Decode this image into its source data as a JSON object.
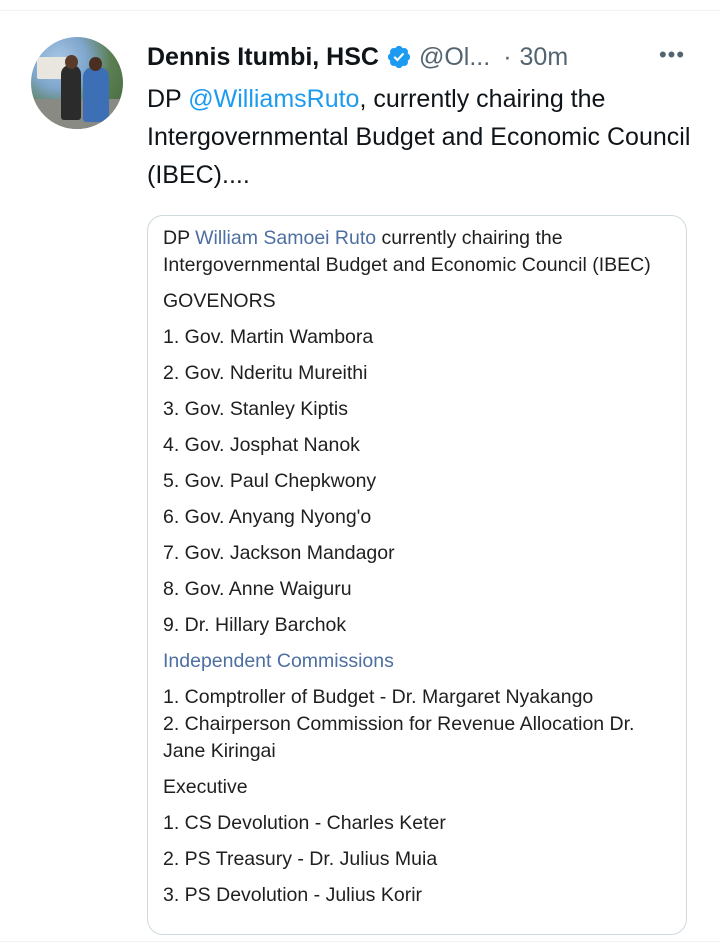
{
  "tweet": {
    "author_name": "Dennis Itumbi, HSC",
    "handle": "@Ol...",
    "separator": "·",
    "time": "30m",
    "more_label": "•••",
    "text_prefix": "DP ",
    "text_mention": "@WilliamsRuto",
    "text_suffix": ", currently chairing the Intergovernmental Budget and Economic Council (IBEC)....",
    "verified_badge_icon": "verified-badge-icon",
    "more_icon": "more-options-icon"
  },
  "card": {
    "intro_prefix": "DP ",
    "intro_link": "William Samoei Ruto",
    "intro_suffix": " currently chairing the Intergovernmental Budget and Economic Council (IBEC)",
    "governors_heading": "GOVENORS",
    "governors": [
      "1. Gov. Martin Wambora",
      "2. Gov. Nderitu Mureithi",
      "3. Gov. Stanley Kiptis",
      "4. Gov. Josphat Nanok",
      "5. Gov. Paul Chepkwony",
      "6. Gov. Anyang Nyong'o",
      "7. Gov. Jackson Mandagor",
      "8. Gov. Anne Waiguru",
      "9. Dr. Hillary Barchok"
    ],
    "commissions_heading": "Independent Commissions",
    "commissions": [
      "1. Comptroller of Budget - Dr. Margaret Nyakango",
      "2. Chairperson Commission for Revenue Allocation Dr. Jane Kiringai"
    ],
    "executive_heading": "Executive",
    "executive": [
      "1. CS Devolution - Charles Keter",
      "2. PS Treasury - Dr. Julius Muia",
      "3. PS Devolution - Julius Korir"
    ]
  },
  "colors": {
    "link_blue": "#1d9bf0",
    "card_link": "#4d6fa1",
    "muted": "#536471",
    "text": "#0f1419",
    "border": "#cfd9de"
  }
}
